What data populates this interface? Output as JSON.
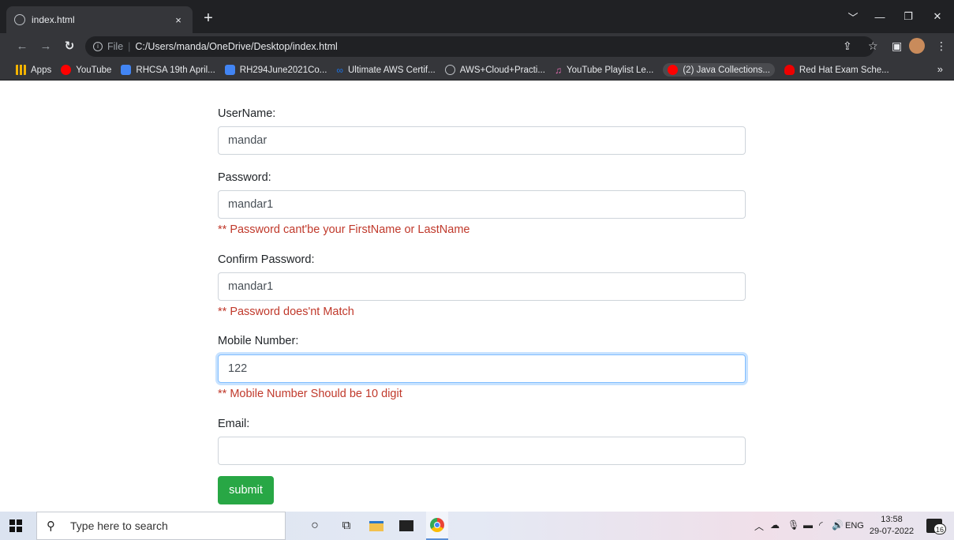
{
  "browser": {
    "tab_title": "index.html",
    "tab_close": "×",
    "new_tab": "+",
    "url_scheme": "File",
    "url": "C:/Users/manda/OneDrive/Desktop/index.html"
  },
  "bookmarks": [
    {
      "label": "Apps",
      "icon": "apps-grid-icon",
      "color": "#f4b400"
    },
    {
      "label": "YouTube",
      "icon": "youtube-icon",
      "color": "#ff0000"
    },
    {
      "label": "RHCSA 19th April...",
      "icon": "docs-icon",
      "color": "#4285f4"
    },
    {
      "label": "RH294June2021Co...",
      "icon": "docs-icon",
      "color": "#4285f4"
    },
    {
      "label": "Ultimate AWS Certif...",
      "icon": "infinity-icon",
      "color": "#1a73e8"
    },
    {
      "label": "AWS+Cloud+Practi...",
      "icon": "globe-icon",
      "color": "#bdc1c6"
    },
    {
      "label": "YouTube Playlist Le...",
      "icon": "playlist-icon",
      "color": "#e06bb0"
    },
    {
      "label": "(2) Java Collections...",
      "icon": "youtube-icon",
      "color": "#ff0000"
    },
    {
      "label": "Red Hat Exam Sche...",
      "icon": "redhat-icon",
      "color": "#ee0000"
    }
  ],
  "bookmarks_more": "»",
  "form": {
    "username_label": "UserName:",
    "username_value": "mandar",
    "password_label": "Password:",
    "password_value": "mandar1",
    "password_error": "** Password cant'be your FirstName or LastName",
    "confirm_label": "Confirm Password:",
    "confirm_value": "mandar1",
    "confirm_error": "** Password does'nt Match",
    "mobile_label": "Mobile Number:",
    "mobile_value": "122",
    "mobile_error": "** Mobile Number Should be 10 digit",
    "email_label": "Email:",
    "email_value": "",
    "submit_label": "submit"
  },
  "taskbar": {
    "search_placeholder": "Type here to search",
    "language": "ENG",
    "time": "13:58",
    "date": "29-07-2022",
    "notifications": "16"
  },
  "colors": {
    "error": "#c0392b",
    "submit": "#28a745",
    "focus": "#80bdff"
  }
}
